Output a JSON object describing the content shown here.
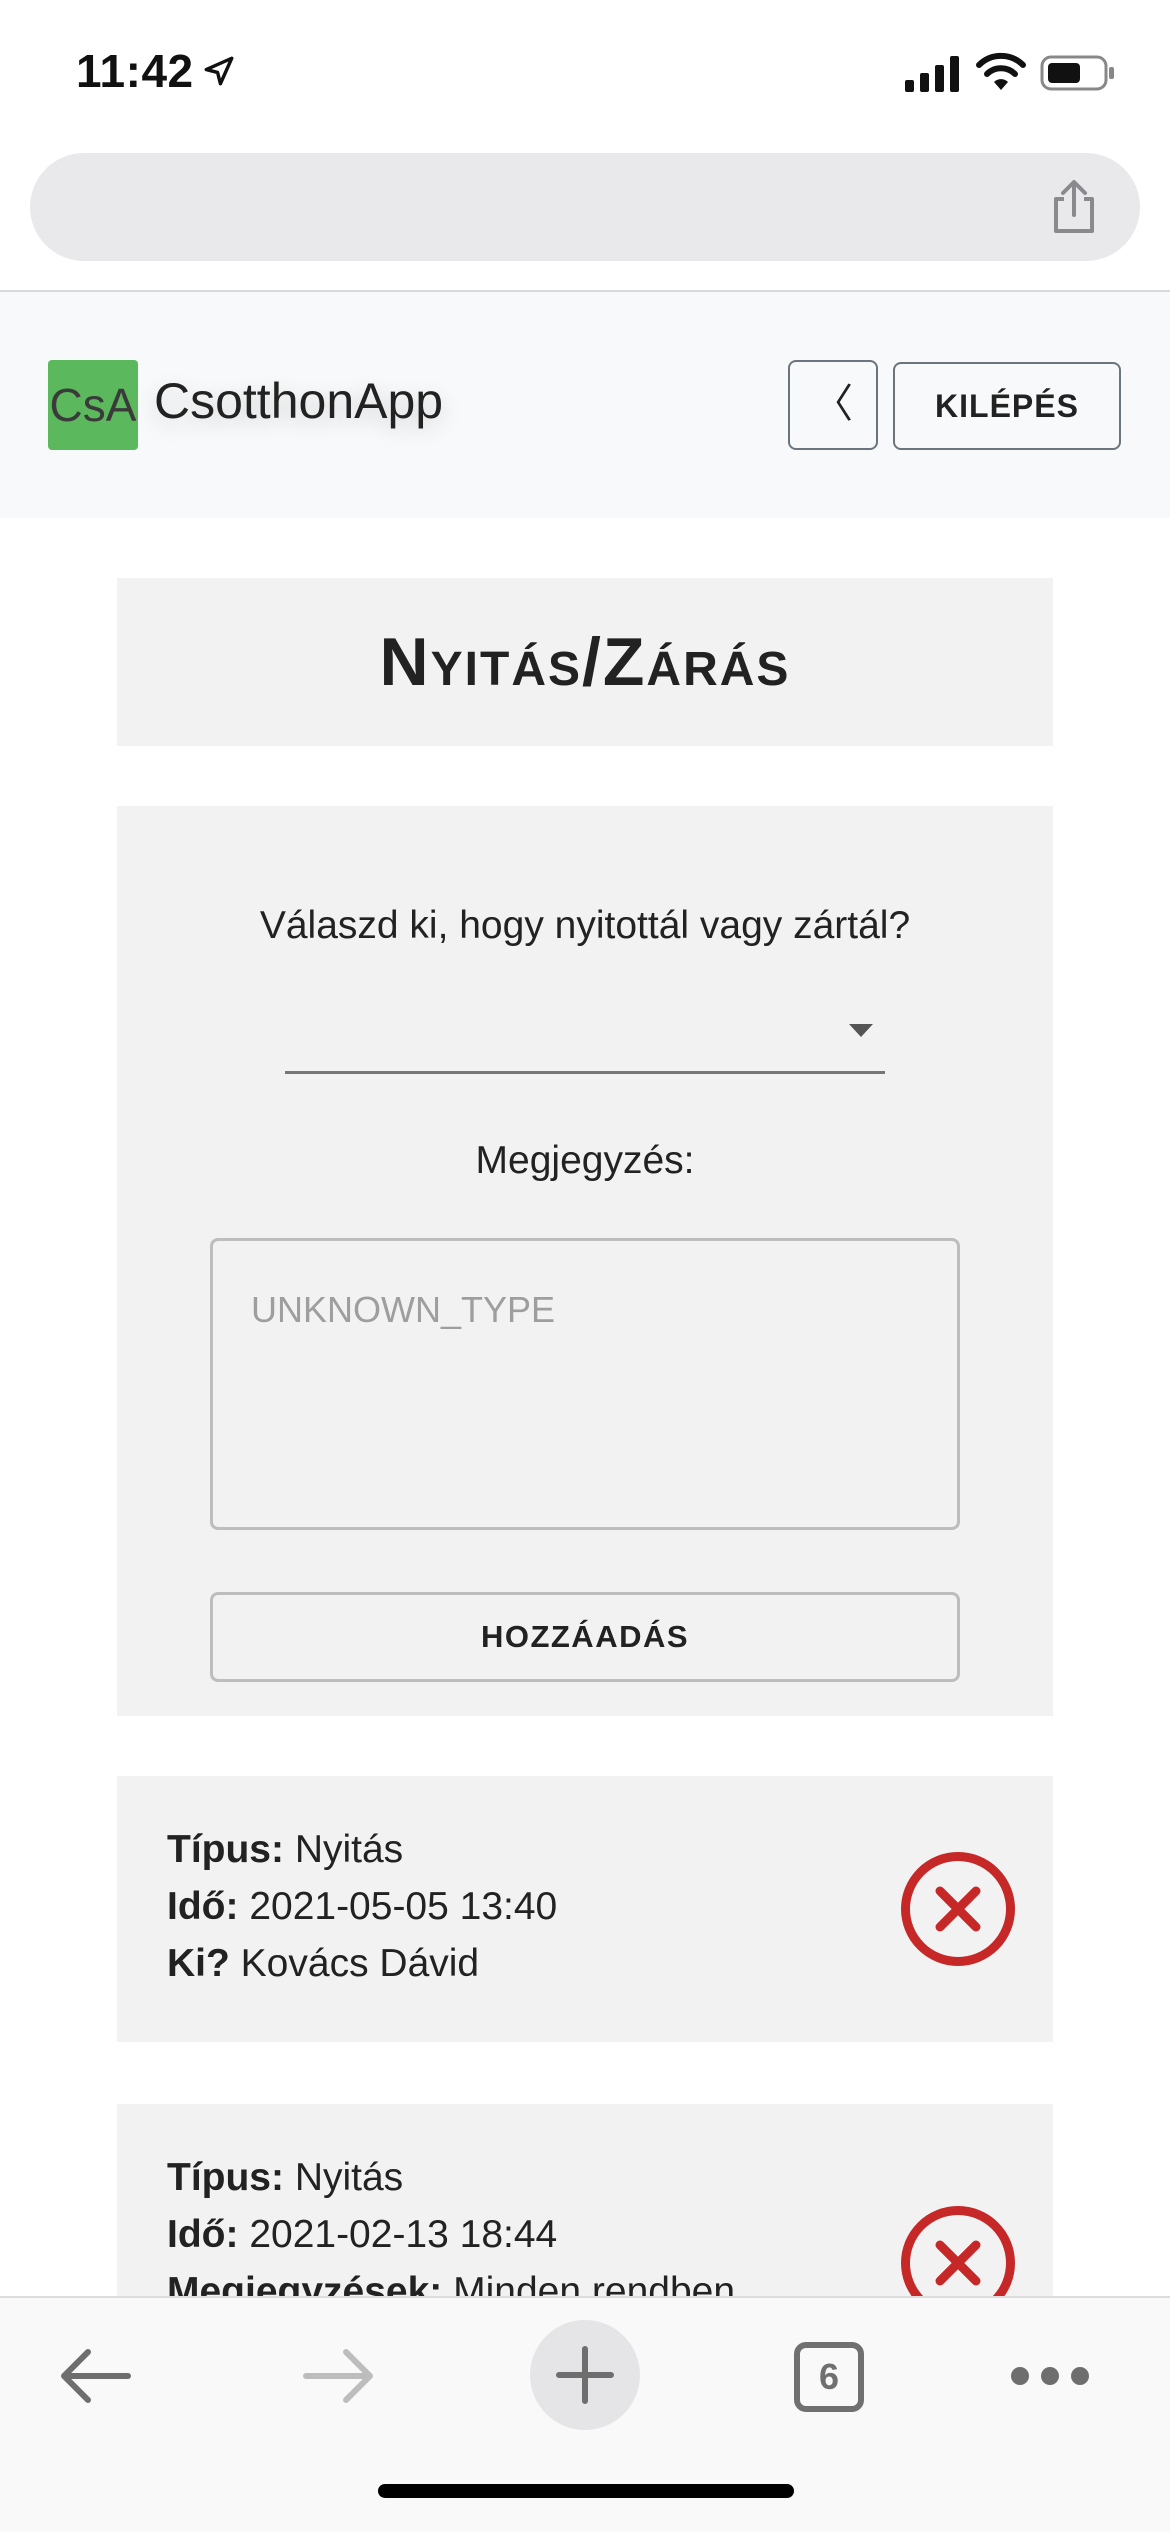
{
  "status_bar": {
    "time": "11:42",
    "icons": [
      "location-arrow-icon",
      "cellular-signal-icon",
      "wifi-icon",
      "battery-icon"
    ]
  },
  "browser": {
    "address_text": "",
    "share_icon": "share-icon",
    "toolbar": {
      "back_icon": "arrow-left-icon",
      "forward_icon": "arrow-right-icon",
      "new_tab_icon": "plus-icon",
      "tab_count": "6",
      "more_icon": "ellipsis-icon"
    }
  },
  "header": {
    "logo_text": "CsA",
    "brand": "CsotthonApp",
    "back_label": "〈",
    "logout_label": "KILÉPÉS"
  },
  "page": {
    "title": "Nyitás/Zárás"
  },
  "form": {
    "question": "Válaszd ki, hogy nyitottál vagy zártál?",
    "type_select_value": "",
    "note_label": "Megjegyzés:",
    "note_placeholder": "UNKNOWN_TYPE",
    "add_label": "HOZZÁADÁS"
  },
  "entries": [
    {
      "type_label": "Típus:",
      "type_value": "Nyitás",
      "time_label": "Idő:",
      "time_value": "2021-05-05 13:40",
      "who_label": "Ki?",
      "who_value": "Kovács Dávid"
    },
    {
      "type_label": "Típus:",
      "type_value": "Nyitás",
      "time_label": "Idő:",
      "time_value": "2021-02-13 18:44",
      "notes_label": "Megjegyzések:",
      "notes_value": "Minden rendben"
    }
  ],
  "colors": {
    "logo_green": "#5cb85c",
    "delete_red": "#c62828",
    "card_bg": "#f2f2f2",
    "header_bg": "#f8f9fa"
  }
}
